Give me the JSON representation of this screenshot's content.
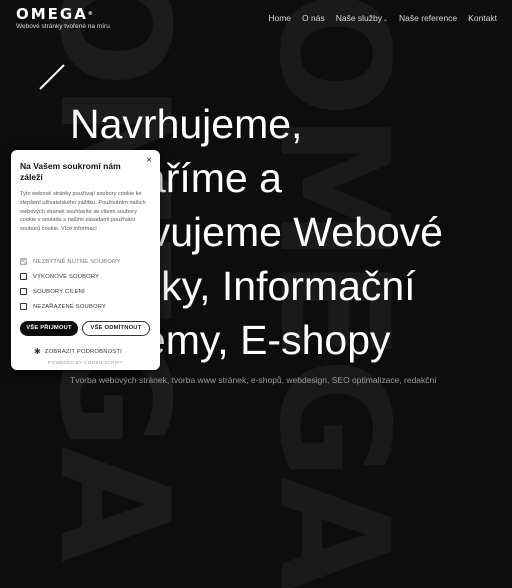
{
  "brand": {
    "name": "OMEGA",
    "mark": "®",
    "tagline": "Webové stránky tvořené na míru"
  },
  "nav": {
    "items": [
      {
        "label": "Home"
      },
      {
        "label": "O nás"
      },
      {
        "label": "Naše služby",
        "has_dropdown": true
      },
      {
        "label": "Naše reference"
      },
      {
        "label": "Kontakt"
      }
    ]
  },
  "hero": {
    "title_lines": [
      "Navrhujeme,",
      "vytváříme a",
      "spravujeme Webové",
      "stránky, Informační",
      "systémy, E-shopy"
    ],
    "subtitle": "Tvorba webových stránek, tvorba www stránek, e-shopů, webdesign, SEO optimalizace, redakční"
  },
  "watermark": {
    "text": "OMEGA"
  },
  "cookie": {
    "title": "Na Vašem soukromí nám záleží",
    "body": "Tyto webové stránky používají soubory cookie ke zlepšení uživatelského zážitku. Používáním našich webových stránek souhlasíte se všemi soubory cookie v souladu s našimi zásadami používání souborů cookie. Více informací",
    "options": [
      {
        "label": "NEZBYTNĚ NUTNÉ SOUBORY",
        "checked": true,
        "disabled": true
      },
      {
        "label": "VÝKONOVÉ SOUBORY",
        "checked": false
      },
      {
        "label": "SOUBORY CÍLENÍ",
        "checked": false
      },
      {
        "label": "NEZAŘAZENÉ SOUBORY",
        "checked": false
      }
    ],
    "accept_label": "VŠE PŘIJMOUT",
    "decline_label": "VŠE ODMÍTNOUT",
    "details_label": "ZOBRAZIT PODROBNOSTI",
    "powered_by": "POWERED BY COOKIESCRIPT",
    "close_label": "×"
  },
  "colors": {
    "background": "#0d0d0d",
    "text": "#ffffff",
    "cookie_bg": "#ffffff",
    "accent_dark": "#0d0d0d"
  }
}
